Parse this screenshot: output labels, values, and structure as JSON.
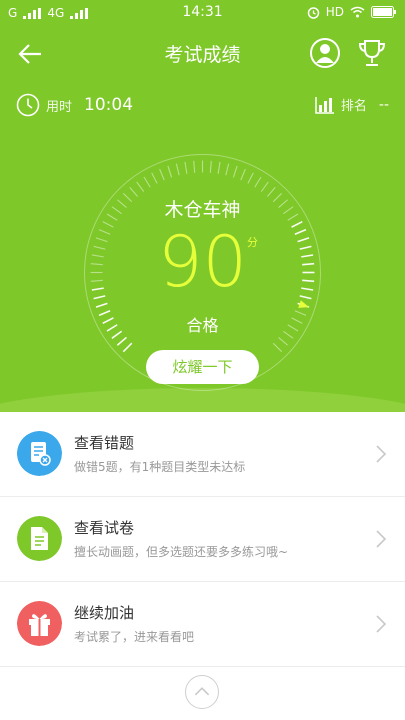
{
  "status_bar": {
    "carrier_1": "G",
    "carrier_2": "4G",
    "time": "14:31",
    "hd": "HD"
  },
  "header": {
    "title": "考试成绩",
    "back_icon": "back-arrow-icon",
    "user_icon": "user-icon",
    "trophy_icon": "trophy-icon"
  },
  "stats": {
    "time_label": "用时",
    "time_value": "10:04",
    "rank_label": "排名",
    "rank_value": "--"
  },
  "result": {
    "title": "木仓车神",
    "score": "90",
    "score_unit": "分",
    "status": "合格",
    "share_button": "炫耀一下"
  },
  "actions": [
    {
      "title": "查看错题",
      "subtitle": "做错5题，有1种题目类型未达标",
      "icon": "wrong-questions-icon",
      "color": "#3aa8ea"
    },
    {
      "title": "查看试卷",
      "subtitle": "擅长动画题，但多选题还要多多练习哦~",
      "icon": "exam-paper-icon",
      "color": "#7ec829"
    },
    {
      "title": "继续加油",
      "subtitle": "考试累了，进来看看吧",
      "icon": "gift-icon",
      "color": "#f06060"
    }
  ],
  "colors": {
    "accent": "#7ec829",
    "score": "#e5ff3a"
  }
}
